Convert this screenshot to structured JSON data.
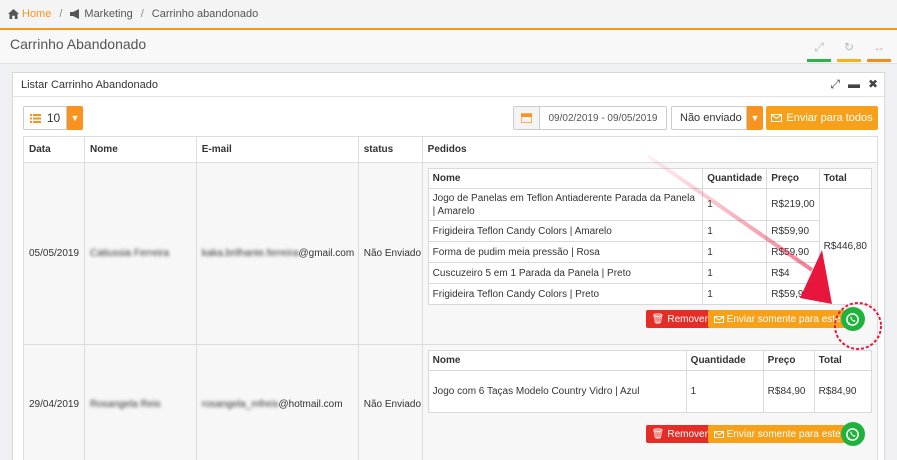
{
  "breadcrumb": {
    "home": "Home",
    "section": "Marketing",
    "page": "Carrinho abandonado"
  },
  "page_title": "Carrinho Abandonado",
  "panel_title": "Listar Carrinho Abandonado",
  "toolbar": {
    "page_size": "10",
    "date_range": "09/02/2019 - 09/05/2019",
    "status_filter": "Não enviado",
    "send_all_label": "Enviar para todos"
  },
  "columns": [
    "Data",
    "Nome",
    "E-mail",
    "status",
    "Pedidos"
  ],
  "sub_columns": [
    "Nome",
    "Quantidade",
    "Preço",
    "Total"
  ],
  "rows": [
    {
      "date": "05/05/2019",
      "name": "Catiussia Ferreira",
      "email_prefix": "kaka.brilhante.ferreira",
      "email_domain": "@gmail.com",
      "status": "Não Enviado",
      "total": "R$446,80",
      "items": [
        {
          "name": "Jogo de Panelas em Teflon Antiaderente Parada da Panela | Amarelo",
          "qty": "1",
          "price": "R$219,00"
        },
        {
          "name": "Frigideira Teflon Candy Colors | Amarelo",
          "qty": "1",
          "price": "R$59,90"
        },
        {
          "name": "Forma de pudim meia pressão | Rosa",
          "qty": "1",
          "price": "R$59,90"
        },
        {
          "name": "Cuscuzeiro 5 em 1 Parada da Panela | Preto",
          "qty": "1",
          "price": "R$4"
        },
        {
          "name": "Frigideira Teflon Candy Colors | Preto",
          "qty": "1",
          "price": "R$59,90"
        }
      ],
      "remove_label": "Remover",
      "send_label": "Enviar somente para este"
    },
    {
      "date": "29/04/2019",
      "name": "Rosangela Reis",
      "email_prefix": "rosangela_mfreis",
      "email_domain": "@hotmail.com",
      "status": "Não Enviado",
      "total": "R$84,90",
      "items": [
        {
          "name": "Jogo com 6 Taças Modelo Country Vidro | Azul",
          "qty": "1",
          "price": "R$84,90"
        }
      ],
      "remove_label": "Remover",
      "send_label": "Enviar somente para este"
    }
  ],
  "icons": {
    "home": "home-icon",
    "marketing": "megaphone-icon",
    "list": "list-icon",
    "calendar": "calendar-icon",
    "envelope": "envelope-icon",
    "trash": "trash-icon",
    "whatsapp": "whatsapp-icon",
    "expand": "expand-icon",
    "refresh": "refresh-icon",
    "close": "close-icon"
  },
  "colors": {
    "accent": "#f7931e",
    "danger": "#e52d27",
    "whatsapp": "#1fb33d",
    "annotation": "#e8163c"
  }
}
